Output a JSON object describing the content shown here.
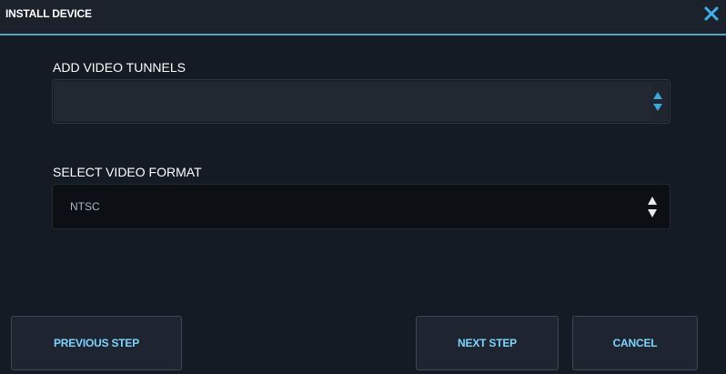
{
  "dialog": {
    "title": "INSTALL DEVICE",
    "close_icon": "close-icon"
  },
  "tunnels": {
    "label": "ADD VIDEO TUNNELS",
    "value": "",
    "spinner_icon": "stepper-arrows-icon",
    "accent": "#3ba7e0"
  },
  "format": {
    "label": "SELECT VIDEO FORMAT",
    "selected": "NTSC",
    "arrows_icon": "select-arrows-icon"
  },
  "buttons": {
    "previous": "PREVIOUS STEP",
    "next": "NEXT STEP",
    "cancel": "CANCEL",
    "text_color": "#7ed3ff"
  }
}
